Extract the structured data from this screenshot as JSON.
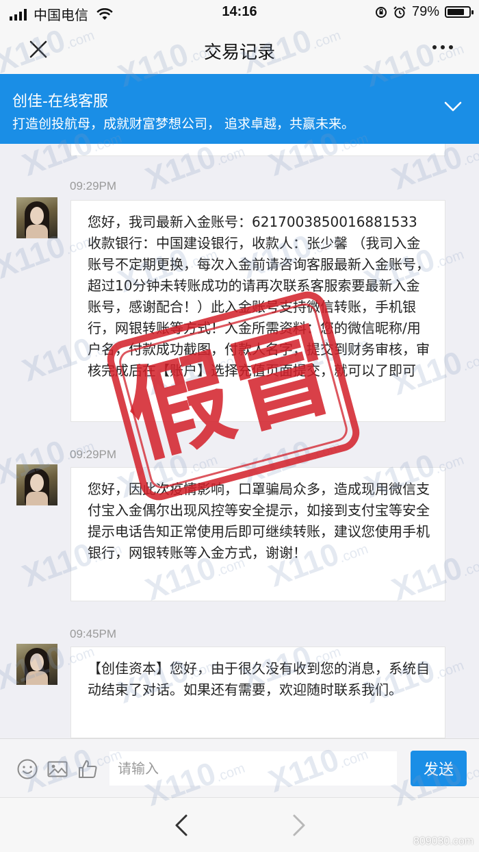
{
  "status_bar": {
    "carrier": "中国电信",
    "time": "14:16",
    "battery": "79%",
    "battery_level": 0.79
  },
  "nav": {
    "title": "交易记录",
    "close_icon": "close-icon",
    "more_icon": "more-icon"
  },
  "header": {
    "name": "创佳-在线客服",
    "slogan": "打造创投航母，成就财富梦想公司， 追求卓越，共赢未来。",
    "toggle_icon": "chevron-down-icon"
  },
  "messages": [
    {
      "time": "09:29PM",
      "text": "您好，我司最新入金账号：6217003850016881533收款银行：中国建设银行，收款人：张少馨 （我司入金账号不定期更换，每次入金前请咨询客服最新入金账号，超过10分钟未转账成功的请再次联系客服索要最新入金账号，感谢配合！）此入金账号支持微信转账，手机银行，网银转账等方式！入金所需资料：您的微信昵称/用户名，付款成功截图，付款人名字，提交到财务审核，审核完成后在【账户】选择充值页面提交，就可以了即可"
    },
    {
      "time": "09:29PM",
      "text": "您好，因此次疫情影响，口罩骗局众多，造成现用微信支付宝入金偶尔出现风控等安全提示，如接到支付宝等安全提示电话告知正常使用后即可继续转账，建议您使用手机银行，网银转账等入金方式，谢谢！"
    },
    {
      "time": "09:45PM",
      "text": "【创佳资本】您好，由于很久没有收到您的消息，系统自动结束了对话。如果还有需要，欢迎随时联系我们。"
    }
  ],
  "input_bar": {
    "placeholder": "请输入",
    "send_label": "发送",
    "icons": [
      "emoji-icon",
      "image-icon",
      "thumbs-up-icon"
    ]
  },
  "bottom_nav": {
    "icons": [
      "back-arrow-icon",
      "forward-arrow-icon"
    ]
  },
  "stamp": {
    "text": "假冒",
    "color": "#d21e28"
  },
  "watermark": {
    "text": "X110",
    "domain": ".com"
  },
  "corner_mark": "809030.com",
  "colors": {
    "accent": "#1a8ee6",
    "background": "#efeff4"
  }
}
